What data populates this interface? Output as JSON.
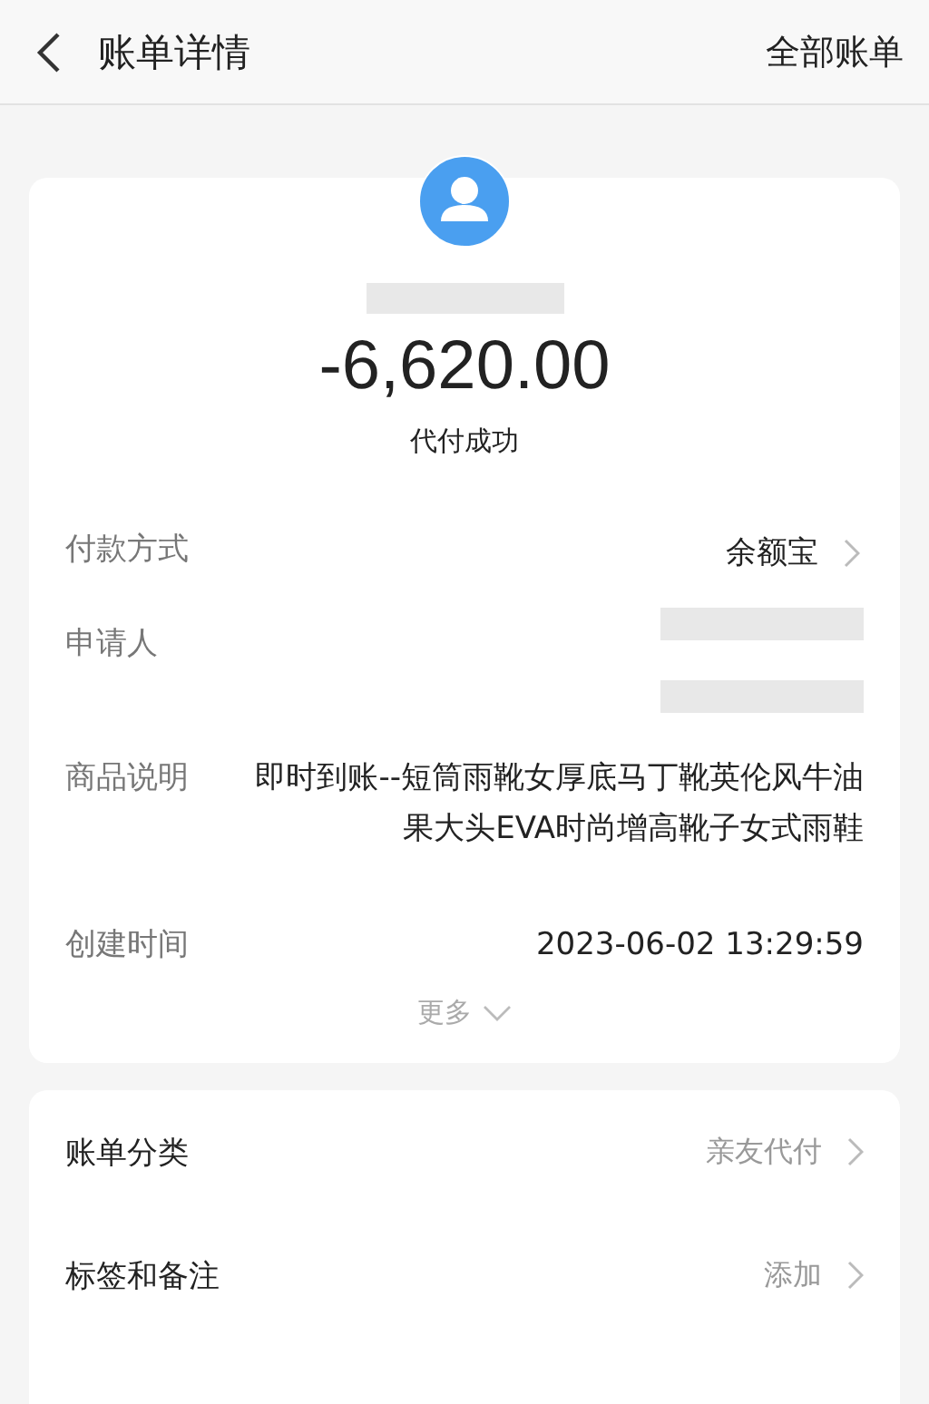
{
  "header": {
    "title": "账单详情",
    "action": "全部账单"
  },
  "summary": {
    "amount": "-6,620.00",
    "status": "代付成功"
  },
  "details": [
    {
      "label": "付款方式",
      "kind": "link",
      "value": "余额宝"
    },
    {
      "label": "申请人",
      "kind": "redacted"
    },
    {
      "label": "商品说明",
      "kind": "text",
      "value": "即时到账--短筒雨靴女厚底马丁靴英伦风牛油果大头EVA时尚增高靴子女式雨鞋"
    },
    {
      "label": "创建时间",
      "kind": "text",
      "value": "2023-06-02 13:29:59"
    }
  ],
  "more": "更多",
  "extras": [
    {
      "label": "账单分类",
      "value": "亲友代付"
    },
    {
      "label": "标签和备注",
      "value": "添加"
    }
  ]
}
